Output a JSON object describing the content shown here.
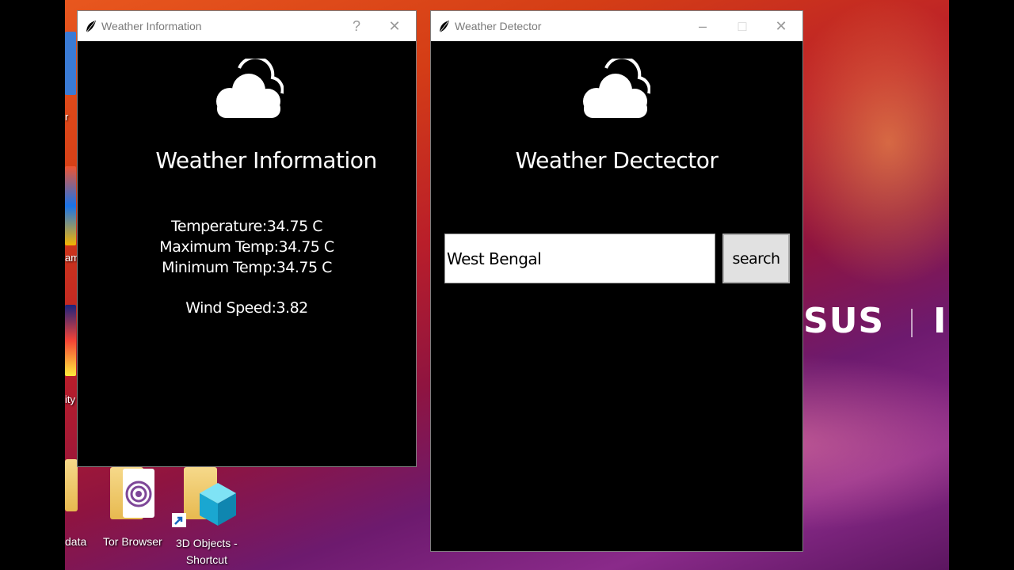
{
  "desktop": {
    "icons": [
      {
        "label": "data"
      },
      {
        "label": "Tor Browser"
      },
      {
        "label": "3D Objects -\nShortcut"
      }
    ],
    "edge_labels": [
      "am",
      "ity",
      "r"
    ],
    "brand_text": "SUS",
    "brand_text_2": "IN"
  },
  "info_window": {
    "title": "Weather Information",
    "help_symbol": "?",
    "close_symbol": "✕",
    "heading": "Weather Information",
    "temperature": "Temperature:34.75 C",
    "max_temp": "Maximum Temp:34.75 C",
    "min_temp": "Minimum Temp:34.75 C",
    "wind_speed": "Wind Speed:3.82"
  },
  "detector_window": {
    "title": "Weather Detector",
    "minimize_symbol": "–",
    "maximize_symbol": "□",
    "close_symbol": "✕",
    "heading": "Weather Dectector",
    "city_value": "West Bengal",
    "search_label": "search"
  }
}
